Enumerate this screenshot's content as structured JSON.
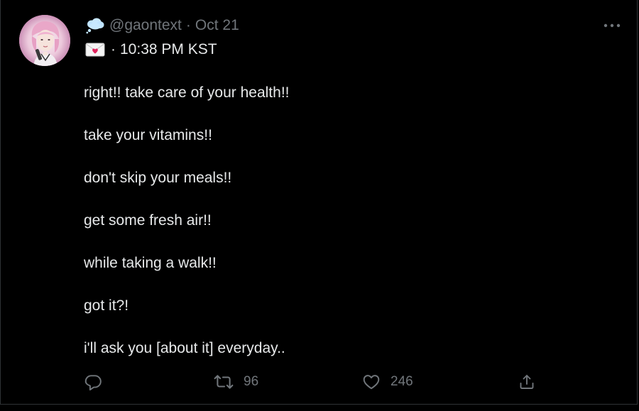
{
  "tweet": {
    "handle": "@gaontext",
    "separator": "·",
    "date": "Oct 21",
    "subline_prefix": "·",
    "time": "10:38 PM KST",
    "lines": [
      "right!! take care of your health!!",
      "take your vitamins!!",
      "don't skip your meals!!",
      "get some fresh air!!",
      "while taking a walk!!",
      "got it?!",
      "i'll ask you [about it] everyday.."
    ],
    "actions": {
      "reply": {
        "icon": "reply-icon",
        "count": ""
      },
      "retweet": {
        "icon": "retweet-icon",
        "count": "96"
      },
      "like": {
        "icon": "heart-icon",
        "count": "246"
      },
      "share": {
        "icon": "share-icon"
      }
    },
    "icons": {
      "name_emoji": "thought-cloud-icon",
      "time_emoji": "love-letter-icon",
      "menu": "more-icon"
    }
  },
  "colors": {
    "background": "#000000",
    "text": "#e7e9ea",
    "muted": "#71767b",
    "border": "#2f3336"
  }
}
